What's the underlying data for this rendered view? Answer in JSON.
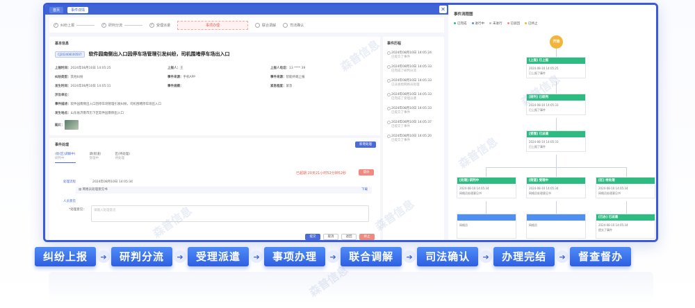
{
  "window": {
    "tabs": [
      "首页",
      "事件详情"
    ],
    "close_icon": "close-icon"
  },
  "steps": [
    "纠纷上报",
    "研判分流",
    "受理派遣",
    "事项办理",
    "联合调解",
    "司法确认"
  ],
  "current_step_index": 3,
  "basic": {
    "section_title": "基本信息",
    "event_id": "CJ202408100507",
    "event_title": "软件园南侧出入口因停车场管理引发纠纷，司机围堵停车场出入口",
    "fields": [
      {
        "label": "上报时间：",
        "value": "2024年08月10日 14:05:25"
      },
      {
        "label": "上报人：",
        "value": "王"
      },
      {
        "label": "上报人电话：",
        "value": "13 **** 39"
      },
      {
        "label": "纠纷类型：",
        "value": "其他纠纷"
      },
      {
        "label": "事件来源：",
        "value": "手机APP"
      },
      {
        "label": "事件来源：",
        "value": "智能终端上报"
      },
      {
        "label": "发生时间：",
        "value": "2024年08月10日 14:05:11"
      },
      {
        "label": "事件规模：",
        "value": ""
      },
      {
        "label": "紧急程度：",
        "value": "紧急"
      },
      {
        "label": "涉及单位：",
        "value": ""
      },
      {
        "label": "事件描述：",
        "value": "软件园南侧出入口因停车场管理引发纠纷，司机围堵停车场出入口"
      },
      {
        "label": "发生地点：",
        "value": "山东省济南市历下区软件园南侧出入口"
      },
      {
        "label": "图片：",
        "value": ""
      }
    ]
  },
  "timeline": {
    "title": "事件历程",
    "items": [
      {
        "time": "2024年08月10日 14:05:24",
        "text": "已提交了事件"
      },
      {
        "time": "2024年08月10日 14:05:33",
        "text": "已完成了研判分流"
      },
      {
        "time": "2024年08月10日 14:05:33",
        "text": "已派发给网格员处理"
      },
      {
        "time": "2024年08月10日 14:05:33",
        "text": "已完成了受理派遣"
      },
      {
        "time": "2024年08月10日 14:05:33",
        "text": "已提交了事件"
      },
      {
        "time": "2024年08月10日 14:05:37",
        "text": "已提交了事件"
      },
      {
        "time": "2024年08月10日 14:05:20",
        "text": "已提交了事件"
      }
    ]
  },
  "handling": {
    "section_title": "事件处理",
    "action_button": "新增处理",
    "tabs": [
      {
        "label": "(街(区)调解中)",
        "sub": "研判中"
      },
      {
        "label": "调(街道)",
        "sub": "受理中"
      },
      {
        "label": "区(待处理)",
        "sub": "待处理"
      }
    ],
    "overdue_text": "已超期 20天21小时52分钟52秒",
    "overdue_button": "督办",
    "receipt_label": "处理流程",
    "receipt_time": "2024年08月10日 14:05:34",
    "attachment_label": "网格员处理意见书",
    "attachment_action": "下载",
    "opinion_label": "人员意见",
    "opinion_field_label": "*处理意见：",
    "opinion_placeholder": "请输入处理意见",
    "buttons": [
      "提交",
      "取消",
      "退回",
      "终止"
    ]
  },
  "flowchart": {
    "title": "事件流程图",
    "legend": [
      {
        "label": "已完成",
        "color": "#2dbb82"
      },
      {
        "label": "进行中",
        "color": "#4f8ff0"
      },
      {
        "label": "未进行",
        "color": "#bbbbbb"
      },
      {
        "label": "已驳回",
        "color": "#f08a7e"
      },
      {
        "label": "已终止",
        "color": "#f2b53a"
      }
    ],
    "start_label": "开始",
    "nodes": [
      {
        "title": "[上报] 已上报",
        "time": "2024-08-10 14:05:25",
        "note": "已上报了事件"
      },
      {
        "title": "[研判] 已研判",
        "time": "2024-08-10 14:05:33",
        "note": "已上报了事件"
      },
      {
        "title": "[受理] 已派遣",
        "time": "2024-08-10 14:05:33",
        "note": "已上报了事件"
      },
      {
        "title": "[处理] 研判中",
        "time": "2024-08-10 14:05:34",
        "note": "网格员处理意见书"
      },
      {
        "title": "[街道] 受理中",
        "time": "2024-08-10 14:05:34",
        "note": "网格员处理意见书"
      },
      {
        "title": "[区] 待处理",
        "time": "2024-08-10 14:05:34",
        "note": "网格员处理意见书"
      },
      {
        "title": "",
        "time": "",
        "note": "网格员"
      },
      {
        "title": "",
        "time": "",
        "note": "网格员"
      },
      {
        "title": "[已办] 已派遣",
        "time": "2024-08-10 14:05:34",
        "note": "提交了事件"
      }
    ]
  },
  "workflow": [
    "纠纷上报",
    "研判分流",
    "受理派遣",
    "事项办理",
    "联合调解",
    "司法确认",
    "办理完结",
    "督查督办"
  ],
  "watermark": "森普信息"
}
